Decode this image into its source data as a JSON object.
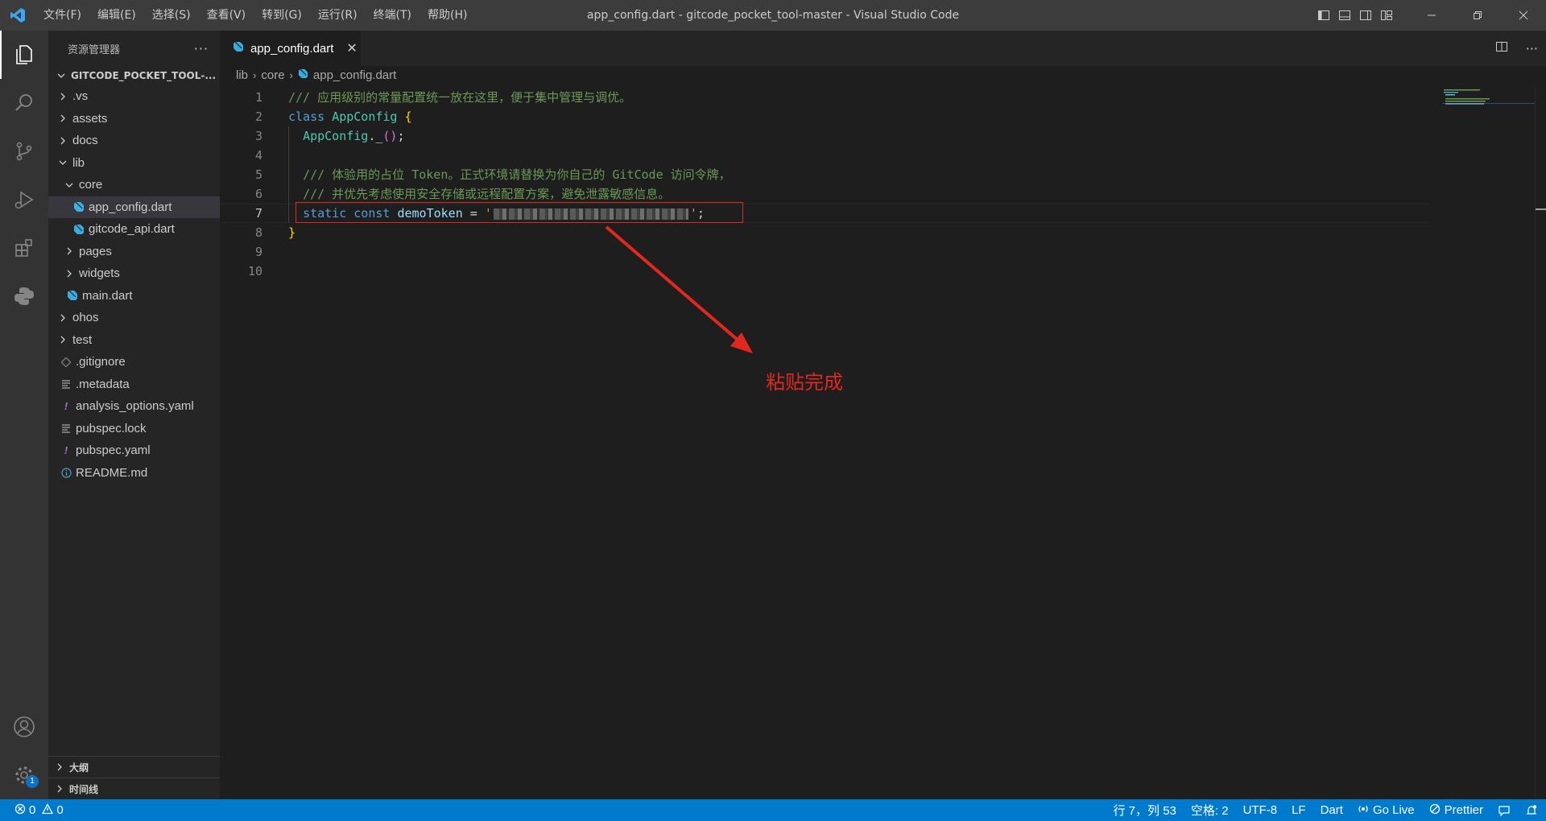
{
  "titlebar": {
    "menus": [
      "文件(F)",
      "编辑(E)",
      "选择(S)",
      "查看(V)",
      "转到(G)",
      "运行(R)",
      "终端(T)",
      "帮助(H)"
    ],
    "window_title": "app_config.dart - gitcode_pocket_tool-master - Visual Studio Code",
    "layout_icons": [
      "toggle-primary-sidebar-icon",
      "toggle-panel-icon",
      "toggle-secondary-sidebar-icon",
      "customize-layout-icon"
    ],
    "window_buttons": [
      "minimize-icon",
      "restore-icon",
      "close-icon"
    ]
  },
  "activitybar": {
    "items": [
      "explorer-icon",
      "search-icon",
      "source-control-icon",
      "run-debug-icon",
      "extensions-icon",
      "python-icon"
    ],
    "bottom": [
      "account-icon",
      "settings-gear-icon"
    ],
    "settings_badge": "1"
  },
  "sidebar": {
    "title": "资源管理器",
    "more": "···",
    "workspace": "GITCODE_POCKET_TOOL-...",
    "tree": [
      {
        "label": ".vs",
        "type": "folder",
        "depth": 0,
        "open": false
      },
      {
        "label": "assets",
        "type": "folder",
        "depth": 0,
        "open": false
      },
      {
        "label": "docs",
        "type": "folder",
        "depth": 0,
        "open": false
      },
      {
        "label": "lib",
        "type": "folder",
        "depth": 0,
        "open": true
      },
      {
        "label": "core",
        "type": "folder",
        "depth": 1,
        "open": true
      },
      {
        "label": "app_config.dart",
        "type": "dart",
        "depth": 2,
        "selected": true
      },
      {
        "label": "gitcode_api.dart",
        "type": "dart",
        "depth": 2
      },
      {
        "label": "pages",
        "type": "folder",
        "depth": 1,
        "open": false
      },
      {
        "label": "widgets",
        "type": "folder",
        "depth": 1,
        "open": false
      },
      {
        "label": "main.dart",
        "type": "dart",
        "depth": 1
      },
      {
        "label": "ohos",
        "type": "folder",
        "depth": 0,
        "open": false
      },
      {
        "label": "test",
        "type": "folder",
        "depth": 0,
        "open": false
      },
      {
        "label": ".gitignore",
        "type": "git",
        "depth": 0
      },
      {
        "label": ".metadata",
        "type": "lines",
        "depth": 0
      },
      {
        "label": "analysis_options.yaml",
        "type": "yaml",
        "depth": 0
      },
      {
        "label": "pubspec.lock",
        "type": "lines",
        "depth": 0
      },
      {
        "label": "pubspec.yaml",
        "type": "yaml",
        "depth": 0
      },
      {
        "label": "README.md",
        "type": "info",
        "depth": 0
      }
    ],
    "sections": [
      "大纲",
      "时间线"
    ]
  },
  "editor": {
    "tab_label": "app_config.dart",
    "breadcrumb": [
      "lib",
      "core",
      "app_config.dart"
    ],
    "lines": [
      {
        "n": "1",
        "tokens": [
          [
            "c-comment",
            "/// 应用级别的常量配置统一放在这里，便于集中管理与调优。"
          ]
        ]
      },
      {
        "n": "2",
        "tokens": [
          [
            "c-kw",
            "class "
          ],
          [
            "c-type",
            "AppConfig "
          ],
          [
            "c-brace",
            "{"
          ]
        ]
      },
      {
        "n": "3",
        "tokens": [
          [
            "c-plain",
            "  "
          ],
          [
            "c-type",
            "AppConfig"
          ],
          [
            "c-plain",
            "._"
          ],
          [
            "c-paren",
            "()"
          ],
          [
            "c-plain",
            ";"
          ]
        ]
      },
      {
        "n": "4",
        "tokens": []
      },
      {
        "n": "5",
        "tokens": [
          [
            "c-plain",
            "  "
          ],
          [
            "c-comment",
            "/// 体验用的占位 Token。正式环境请替换为你自己的 GitCode 访问令牌，"
          ]
        ]
      },
      {
        "n": "6",
        "tokens": [
          [
            "c-plain",
            "  "
          ],
          [
            "c-comment",
            "/// 并优先考虑使用安全存储或远程配置方案，避免泄露敏感信息。"
          ]
        ]
      },
      {
        "n": "7",
        "tokens": [
          [
            "c-plain",
            "  "
          ],
          [
            "c-kw",
            "static const "
          ],
          [
            "c-var",
            "demoToken"
          ],
          [
            "c-plain",
            " = "
          ],
          [
            "c-string",
            "'"
          ],
          [
            "redacted",
            ""
          ],
          [
            "c-string",
            "'"
          ],
          [
            "c-plain",
            ";"
          ]
        ],
        "current": true
      },
      {
        "n": "8",
        "tokens": [
          [
            "c-brace",
            "}"
          ]
        ]
      },
      {
        "n": "9",
        "tokens": []
      },
      {
        "n": "10",
        "tokens": []
      }
    ],
    "annotation": "粘贴完成"
  },
  "statusbar": {
    "errors": "0",
    "warnings": "0",
    "position": "行 7，列 53",
    "spaces": "空格: 2",
    "encoding": "UTF-8",
    "eol": "LF",
    "language": "Dart",
    "golive": "Go Live",
    "prettier": "Prettier"
  },
  "colors": {
    "accent": "#007acc",
    "annotation": "#e0281f"
  }
}
